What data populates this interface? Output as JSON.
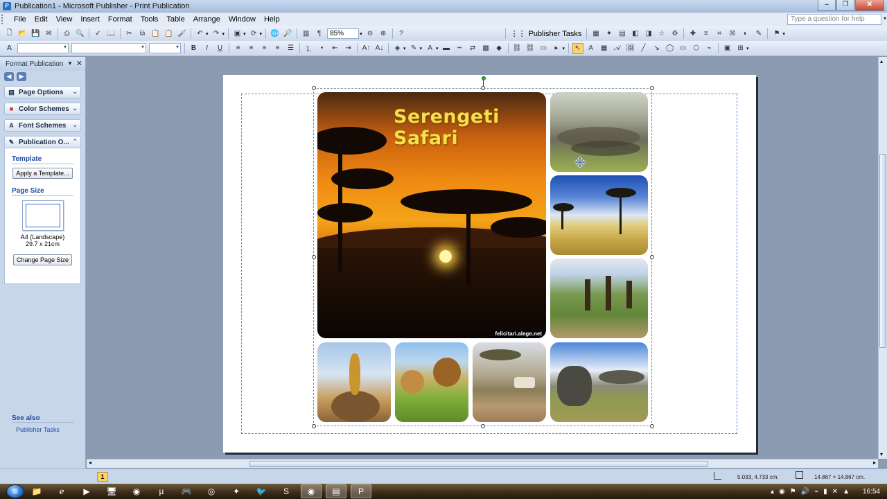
{
  "window": {
    "title": "Publication1 - Microsoft Publisher - Print Publication",
    "app_icon": "P"
  },
  "menu": [
    "File",
    "Edit",
    "View",
    "Insert",
    "Format",
    "Tools",
    "Table",
    "Arrange",
    "Window",
    "Help"
  ],
  "help_box": {
    "placeholder": "Type a question for help"
  },
  "toolbar": {
    "zoom": "85%",
    "publisher_tasks": "Publisher Tasks"
  },
  "taskpane": {
    "title": "Format Publication",
    "sections": [
      {
        "label": "Page Options",
        "icon": "page-options-icon"
      },
      {
        "label": "Color Schemes",
        "icon": "color-schemes-icon"
      },
      {
        "label": "Font Schemes",
        "icon": "font-schemes-icon"
      },
      {
        "label": "Publication O...",
        "icon": "publication-options-icon"
      }
    ],
    "template_label": "Template",
    "apply_template": "Apply a Template...",
    "page_size_label": "Page Size",
    "page_size_name": "A4 (Landscape)",
    "page_size_dims": "29.7 x 21cm",
    "change_page_size": "Change Page Size",
    "see_also": "See also",
    "publisher_tasks_link": "Publisher Tasks"
  },
  "document": {
    "hero_title": "Serengeti Safari",
    "hero_credit": "felicitari.alege.net"
  },
  "status": {
    "page": "1",
    "position": "5.033, 4.733 cm.",
    "size": "14.867 × 14.867 cm."
  },
  "clock": "16:54"
}
